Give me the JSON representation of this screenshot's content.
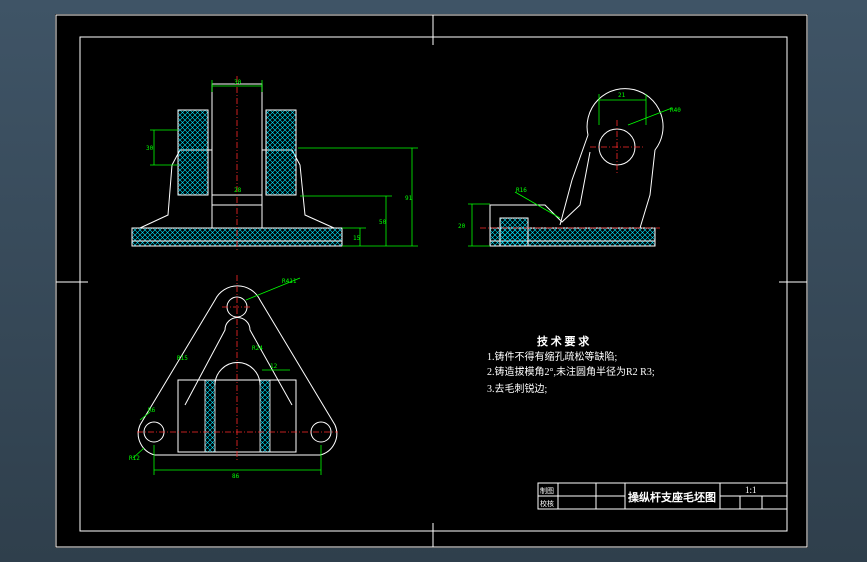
{
  "drawing": {
    "dims": {
      "front_top_width": "30",
      "front_flange_height": "30",
      "front_bore": "28",
      "front_total_height": "91",
      "front_mid_height": "50",
      "front_base_height": "15",
      "side_boss_offset": "21",
      "side_boss_radius": "R40",
      "side_fillet": "R16",
      "side_base_height": "20",
      "plan_outer_radius": "R411",
      "plan_arm": "R15",
      "plan_inner": "R24",
      "plan_hole": "R6",
      "plan_edge_radius": "R12",
      "plan_slot_width": "12",
      "plan_hole_spacing": "86"
    },
    "tech_requirements": {
      "title": "技 术 要 求",
      "items": [
        "1.铸件不得有缩孔疏松等缺陷;",
        "2.铸造拔模角2°,未注圆角半径为R2   R3;",
        "3.去毛刺锐边;"
      ]
    },
    "title_block": {
      "label_drawn": "制图",
      "label_checked": "校核",
      "drawing_title": "操纵杆支座毛坯图",
      "scale": "1:1"
    }
  },
  "colors": {
    "line": "#ffffff",
    "dimension": "#00ff00",
    "hatch": "#00e5ff",
    "centerline": "#ff2a2a",
    "background": "#000000"
  }
}
